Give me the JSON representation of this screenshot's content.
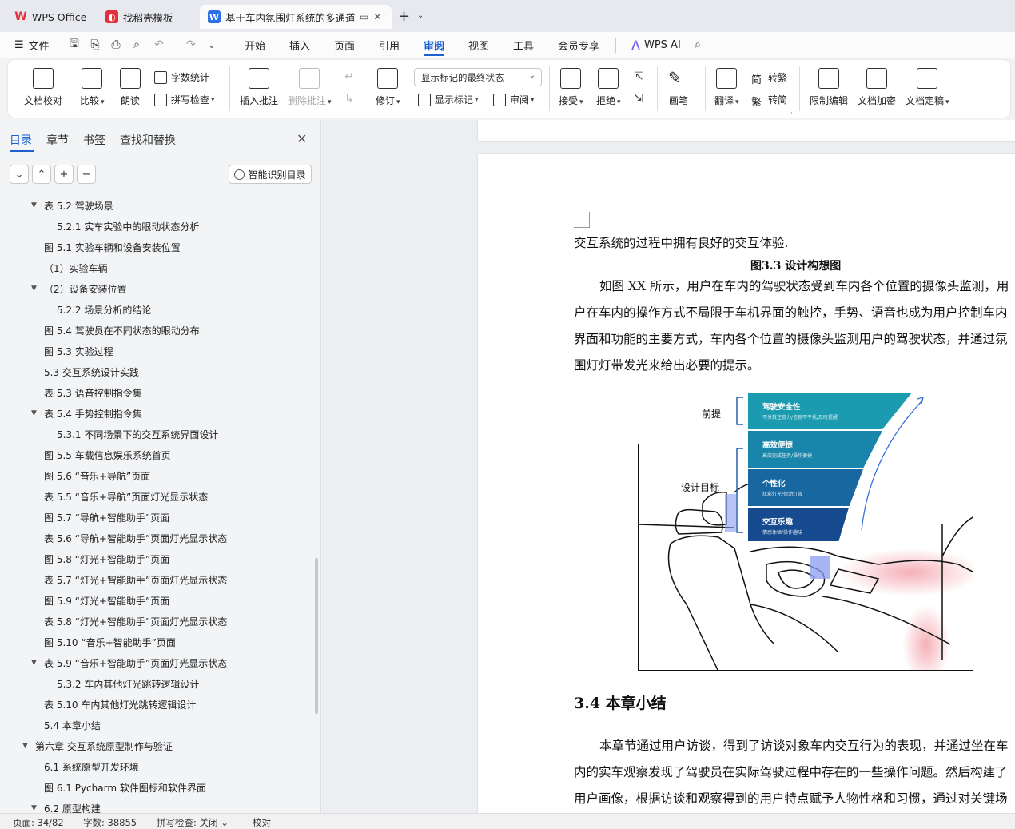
{
  "titlebar": {
    "tabs": [
      {
        "label": "WPS Office",
        "icon": "wps-logo-icon"
      },
      {
        "label": "找稻壳模板",
        "icon": "docer-icon"
      },
      {
        "label": "基于车内氛围灯系统的多通道",
        "icon": "word-doc-icon"
      }
    ]
  },
  "menu": {
    "file": "文件",
    "items": [
      "开始",
      "插入",
      "页面",
      "引用",
      "审阅",
      "视图",
      "工具",
      "会员专享"
    ],
    "active": "审阅",
    "wps_ai": "WPS AI"
  },
  "ribbon": {
    "proofread": "文档校对",
    "compare": "比较",
    "read_aloud": "朗读",
    "word_count": "字数统计",
    "spell_check": "拼写检查",
    "insert_comment": "插入批注",
    "delete_comment": "删除批注",
    "revise": "修订",
    "markup_state": "显示标记的最终状态",
    "show_markup": "显示标记",
    "review": "审阅",
    "accept": "接受",
    "reject": "拒绝",
    "pen": "画笔",
    "translate": "翻译",
    "to_traditional": "转繁",
    "to_simplified": "转简",
    "restrict_edit": "限制编辑",
    "encrypt": "文档加密",
    "finalize": "文档定稿"
  },
  "nav_panel": {
    "tabs": [
      "目录",
      "章节",
      "书签",
      "查找和替换"
    ],
    "smart_toc": "智能识别目录",
    "toc": [
      {
        "text": "表 5.2  驾驶场景",
        "level": 2,
        "expanded": true
      },
      {
        "text": "5.2.1 实车实验中的眼动状态分析",
        "level": 3
      },
      {
        "text": "图 5.1  实验车辆和设备安装位置",
        "level": 2
      },
      {
        "text": "（1）实验车辆",
        "level": 2
      },
      {
        "text": "（2）设备安装位置",
        "level": 2,
        "expanded": true
      },
      {
        "text": "5.2.2 场景分析的结论",
        "level": 3
      },
      {
        "text": "图 5.4  驾驶员在不同状态的眼动分布",
        "level": 2
      },
      {
        "text": "图 5.3  实验过程",
        "level": 2
      },
      {
        "text": "5.3 交互系统设计实践",
        "level": 2
      },
      {
        "text": "表 5.3  语音控制指令集",
        "level": 2
      },
      {
        "text": "表 5.4  手势控制指令集",
        "level": 2,
        "expanded": true
      },
      {
        "text": "5.3.1 不同场景下的交互系统界面设计",
        "level": 3
      },
      {
        "text": "图 5.5  车载信息娱乐系统首页",
        "level": 2
      },
      {
        "text": "图 5.6  “音乐+导航”页面",
        "level": 2
      },
      {
        "text": "表 5.5  “音乐+导航”页面灯光显示状态",
        "level": 2
      },
      {
        "text": "图 5.7  “导航+智能助手”页面",
        "level": 2
      },
      {
        "text": "表 5.6  “导航+智能助手”页面灯光显示状态",
        "level": 2
      },
      {
        "text": "图 5.8  “灯光+智能助手”页面",
        "level": 2
      },
      {
        "text": "表 5.7  “灯光+智能助手”页面灯光显示状态",
        "level": 2
      },
      {
        "text": "图 5.9  “灯光+智能助手”页面",
        "level": 2
      },
      {
        "text": "表 5.8  “灯光+智能助手”页面灯光显示状态",
        "level": 2
      },
      {
        "text": "图 5.10  “音乐+智能助手”页面",
        "level": 2
      },
      {
        "text": "表 5.9  “音乐+智能助手”页面灯光显示状态",
        "level": 2,
        "expanded": true
      },
      {
        "text": "5.3.2 车内其他灯光跳转逻辑设计",
        "level": 3
      },
      {
        "text": "表 5.10  车内其他灯光跳转逻辑设计",
        "level": 2
      },
      {
        "text": "5.4 本章小结",
        "level": 2
      },
      {
        "text": "第六章  交互系统原型制作与验证",
        "level": 1,
        "expanded": true
      },
      {
        "text": "6.1 系统原型开发环境",
        "level": 2
      },
      {
        "text": "图 6.1 Pycharm 软件图标和软件界面",
        "level": 2
      },
      {
        "text": "6.2 原型构建",
        "level": 2,
        "expanded": true
      }
    ]
  },
  "document": {
    "line1": "交互系统的过程中拥有良好的交互体验.",
    "figure_caption": "图3.3  设计构想图",
    "para1": [
      "如图 XX 所示，用户在车内的驾驶状态受到车内各个位置的摄像头监测，用",
      "户在车内的操作方式不局限于车机界面的触控，手势、语音也成为用户控制车内",
      "界面和功能的主要方式，车内各个位置的摄像头监测用户的驾驶状态，并通过氛",
      "围灯灯带发光来给出必要的提示。"
    ],
    "figure": {
      "label_premise": "前提",
      "label_goal": "设计目标",
      "levels": [
        {
          "title": "驾驶安全性",
          "sub": "不分散注意力/信息不干扰/及时提醒",
          "color": "#1a9bb0"
        },
        {
          "title": "高效便捷",
          "sub": "高效完成任务/操作便捷",
          "color": "#1985ab"
        },
        {
          "title": "个性化",
          "sub": "炫彩灯光/律动灯效",
          "color": "#1967a0"
        },
        {
          "title": "交互乐趣",
          "sub": "情感体验/操作趣味",
          "color": "#164b8f"
        }
      ]
    },
    "section_heading": "3.4 本章小结",
    "para2": [
      "本章节通过用户访谈，得到了访谈对象车内交互行为的表现，并通过坐在车",
      "内的实车观察发现了驾驶员在实际驾驶过程中存在的一些操作问题。然后构建了",
      "用户画像，根据访谈和观察得到的用户特点赋予人物性格和习惯，通过对关键场"
    ]
  },
  "statusbar": {
    "page": "页面: 34/82",
    "words": "字数: 38855",
    "spell": "拼写检查: 关闭",
    "proof": "校对"
  }
}
